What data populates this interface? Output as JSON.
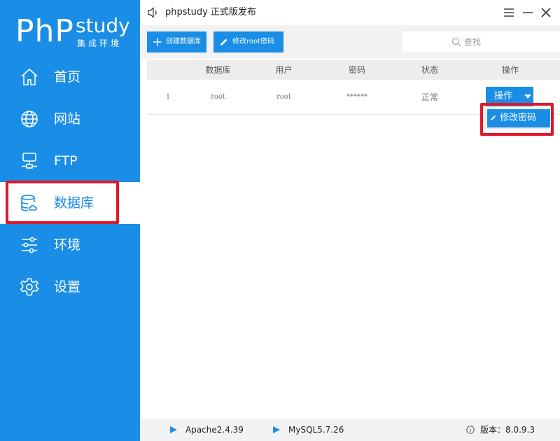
{
  "app": {
    "logo": {
      "brand": "PhP",
      "product": "study",
      "subtitle": "集成环境"
    },
    "title": "phpstudy 正式版发布"
  },
  "sidebar": {
    "items": [
      {
        "label": "首页",
        "icon": "home-icon",
        "active": false
      },
      {
        "label": "网站",
        "icon": "globe-icon",
        "active": false
      },
      {
        "label": "FTP",
        "icon": "ftp-server-icon",
        "active": false
      },
      {
        "label": "数据库",
        "icon": "database-icon",
        "active": true
      },
      {
        "label": "环境",
        "icon": "sliders-icon",
        "active": false
      },
      {
        "label": "设置",
        "icon": "gear-icon",
        "active": false
      }
    ]
  },
  "toolbar": {
    "create_db_label": "创建数据库",
    "change_root_pwd_label": "修改root密码",
    "search_placeholder": "查找"
  },
  "table": {
    "columns": [
      "",
      "数据库",
      "用户",
      "密码",
      "状态",
      "操作"
    ],
    "rows": [
      {
        "index": "1",
        "database": "root",
        "user": "root",
        "password": "******",
        "status": "正常",
        "action_label": "操作"
      }
    ]
  },
  "dropdown": {
    "items": [
      {
        "label": "修改密码"
      }
    ]
  },
  "statusbar": {
    "services": [
      {
        "label": "Apache2.4.39"
      },
      {
        "label": "MySQL5.7.26"
      }
    ],
    "version_label": "版本：8.0.9.3"
  },
  "colors": {
    "accent": "#1a8ee6",
    "highlight": "#e0182b",
    "toolbar_bg": "#f2f2f2",
    "header_bg": "#ededed"
  }
}
